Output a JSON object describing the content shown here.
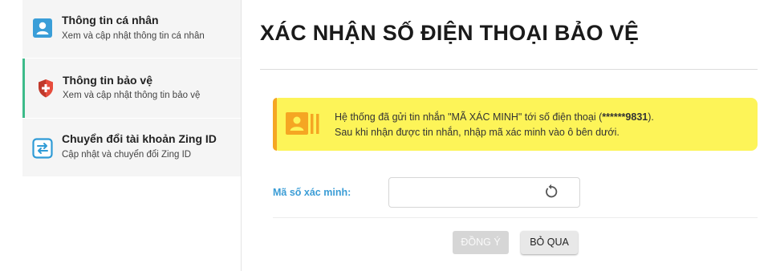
{
  "sidebar": {
    "items": [
      {
        "title": "Thông tin cá nhân",
        "subtitle": "Xem và cập nhật thông tin cá nhân",
        "icon": "user-card-icon"
      },
      {
        "title": "Thông tin bảo vệ",
        "subtitle": "Xem và cập nhật thông tin bảo vệ",
        "icon": "shield-icon",
        "active": true
      },
      {
        "title": "Chuyển đổi tài khoản Zing ID",
        "subtitle": "Cập nhật và chuyển đổi Zing ID",
        "icon": "swap-icon"
      }
    ]
  },
  "main": {
    "title": "XÁC NHẬN SỐ ĐIỆN THOẠI BẢO VỆ",
    "notice": {
      "line1_prefix": "Hệ thống đã gửi tin nhắn \"MÃ XÁC MINH\" tới số điện thoại (",
      "phone": "******9831",
      "line1_suffix": ").",
      "line2": "Sau khi nhận được tin nhắn, nhập mã xác minh vào ô bên dưới.",
      "icon": "id-card-icon"
    },
    "form": {
      "code_label": "Mã số xác minh:",
      "code_value": "",
      "code_placeholder": ""
    },
    "buttons": {
      "confirm_label": "ĐỒNG Ý",
      "skip_label": "BỎ QUA"
    }
  },
  "colors": {
    "active_accent": "#3dbb8a",
    "notice_bg": "#fdf458",
    "notice_accent": "#f5a623",
    "label_blue": "#3b9dd6"
  }
}
